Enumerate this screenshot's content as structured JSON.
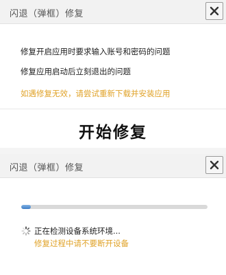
{
  "repair_dialog": {
    "title": "闪退（弹框）修复",
    "issues": [
      "修复开启应用时要求输入账号和密码的问题",
      "修复应用启动后立刻退出的问题"
    ],
    "hint": "如遇修复无效，请尝试重新下载并安装应用",
    "start_button_label": "开始修复",
    "close_icon": "close-icon"
  },
  "progress_dialog": {
    "title": "闪退（弹框）修复",
    "progress_fraction": 0.05,
    "status_text": "正在检测设备系统环境...",
    "warning_text": "修复过程中请不要断开设备",
    "spinner_icon": "loading-spinner-icon",
    "close_icon": "close-icon"
  },
  "colors": {
    "titlebar_bg": "#f2f2f2",
    "warning_text": "#e0a32a",
    "progress_fill": "#3f7fc6",
    "progress_track": "#d9d9d9"
  }
}
